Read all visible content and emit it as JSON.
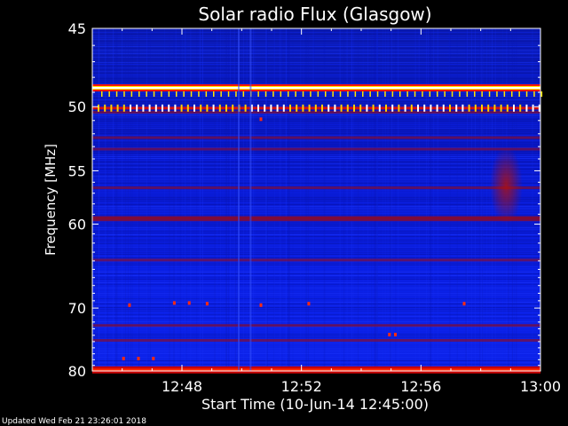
{
  "chart_data": {
    "type": "heatmap",
    "title": "Solar radio Flux (Glasgow)",
    "xlabel": "Start Time (10-Jun-14 12:45:00)",
    "ylabel": "Frequency [MHz]",
    "x_range_minutes": [
      0,
      15
    ],
    "x_ticks": [
      {
        "label": "12:48",
        "minutes": 3
      },
      {
        "label": "12:52",
        "minutes": 7
      },
      {
        "label": "12:56",
        "minutes": 11
      },
      {
        "label": "13:00",
        "minutes": 15
      }
    ],
    "y_ticks": [
      45,
      50,
      55,
      60,
      70,
      80
    ],
    "ylim_mhz": [
      45,
      80
    ],
    "y_scale": "reciprocal (frequency increases downward, non-linear)",
    "colormap": [
      "#00006a",
      "#0000ff",
      "#ff0000",
      "#ffff00",
      "#ffffff"
    ],
    "background_level": "low (blue)",
    "bright_bands_mhz": [
      {
        "freq": 48.7,
        "level": "saturated (white/yellow), continuous"
      },
      {
        "freq": 50.1,
        "level": "high, intermittent"
      },
      {
        "freq": 79.8,
        "level": "high (red), continuous"
      }
    ],
    "moderate_bands_mhz": [
      50.4,
      52.3,
      53.2,
      56.5,
      59.4,
      63.9,
      72.5,
      74.8
    ],
    "enhanced_region": {
      "minutes": [
        13.3,
        14.4
      ],
      "mhz": [
        53,
        60
      ],
      "level": "moderate (red)"
    },
    "features": [
      {
        "type": "vertical line",
        "minutes": 5.3
      },
      {
        "type": "vertical line",
        "minutes": 4.9
      }
    ]
  },
  "footer": {
    "updated": "Updated Wed Feb 21 23:26:01 2018"
  }
}
